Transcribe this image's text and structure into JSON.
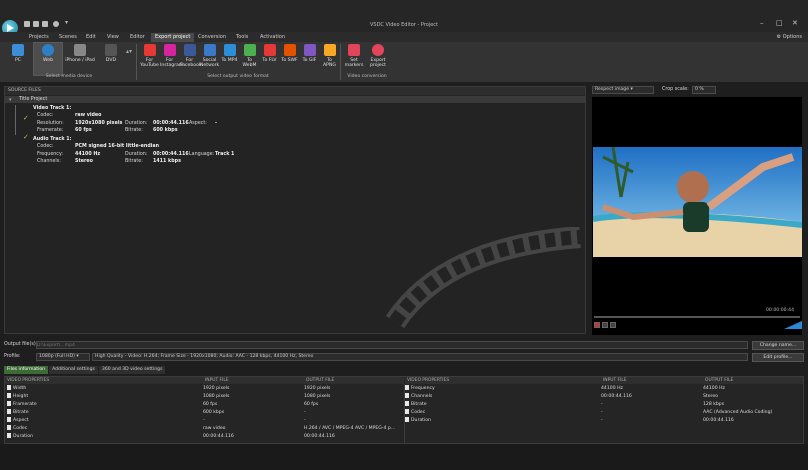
{
  "window": {
    "title": "VSDC Video Editor - Project",
    "controls": [
      "–",
      "□",
      "✕"
    ]
  },
  "menu": {
    "tabs": [
      "Projects",
      "Scenes",
      "Edit",
      "View",
      "Editor",
      "Export project",
      "Conversion",
      "Tools",
      "Activation"
    ],
    "active": "Export project",
    "options": "Options"
  },
  "ribbon": {
    "media_buttons": [
      "PC",
      "Web",
      "iPhone / iPad",
      "DVD"
    ],
    "media_group": "Select media device",
    "format_buttons": [
      "For YouTube",
      "For Instagram",
      "For Facebook",
      "Social Network",
      "To MP4",
      "To WebM",
      "To FLV",
      "To SWF",
      "To GIF",
      "To APNG"
    ],
    "format_colors": [
      "#e53935",
      "#d6249f",
      "#3b5998",
      "#3a79c9",
      "#2a8fd8",
      "#4caf50",
      "#e53935",
      "#e65100",
      "#7e57c2",
      "#f9a825"
    ],
    "format_group": "Select output video format",
    "conv_buttons": [
      "Set markers",
      "Export project"
    ],
    "conv_group": "Video conversion"
  },
  "source": {
    "header": "SOURCE FILES",
    "project": "Title Project",
    "video_track": {
      "label": "Video Track 1:",
      "codec_label": "Codec:",
      "codec": "raw video",
      "res_label": "Resolution:",
      "res": "1920x1080 pixels",
      "dur_label": "Duration:",
      "dur": "00:00:44.116",
      "aspect_label": "Aspect:",
      "aspect": "-",
      "fr_label": "Framerate:",
      "fr": "60 fps",
      "br_label": "Bitrate:",
      "br": "600 kbps"
    },
    "audio_track": {
      "label": "Audio Track 1:",
      "codec_label": "Codec:",
      "codec": "PCM signed 16-bit little-endian",
      "freq_label": "Frequency:",
      "freq": "44100 Hz",
      "dur_label": "Duration:",
      "dur": "00:00:44.116",
      "lang_label": "Language:",
      "lang": "Track 1",
      "ch_label": "Channels:",
      "ch": "Stereo",
      "br_label": "Bitrate:",
      "br": "1411 kbps"
    }
  },
  "preview": {
    "mode": "Respect image",
    "crop_label": "Crop scale:",
    "crop_value": "0 %",
    "time": "00:00:00:44"
  },
  "output": {
    "file_label": "Output file(s):",
    "file_placeholder": "D:\\Export\\...mp4",
    "change_btn": "Change name...",
    "profile_label": "Profile:",
    "profile": "1080p (Full HD)",
    "profile_desc": "High Quality - Video: H.264; Frame Size - 1920x1080; Audio: AAC - 128 kbps, 44100 Hz, Stereo",
    "edit_btn": "Edit profile..."
  },
  "tabs": [
    "Files information",
    "Additional settings",
    "360 and 3D video settings"
  ],
  "props": {
    "video_headers": [
      "VIDEO PROPERTIES",
      "INPUT FILE",
      "OUTPUT FILE"
    ],
    "video_rows": [
      [
        "Width",
        "1920 pixels",
        "1920 pixels"
      ],
      [
        "Height",
        "1080 pixels",
        "1080 pixels"
      ],
      [
        "Framerate",
        "60 fps",
        "60 fps"
      ],
      [
        "Bitrate",
        "600 kbps",
        "-"
      ],
      [
        "Aspect",
        "-",
        "-"
      ],
      [
        "Codec",
        "raw video",
        "H.264 / AVC / MPEG-4 AVC / MPEG-4 p..."
      ],
      [
        "Duration",
        "00:00:44.116",
        "00:00:44.116"
      ]
    ],
    "audio_headers": [
      "VIDEO PROPERTIES",
      "INPUT FILE",
      "OUTPUT FILE"
    ],
    "audio_rows": [
      [
        "Frequency",
        "44100 Hz",
        "44100 Hz"
      ],
      [
        "Channels",
        "00:00:44.116",
        "Stereo"
      ],
      [
        "Bitrate",
        "-",
        "128 kbps"
      ],
      [
        "Codec",
        "-",
        "AAC (Advanced Audio Coding)"
      ],
      [
        "Duration",
        "-",
        "00:00:44.116"
      ]
    ]
  }
}
